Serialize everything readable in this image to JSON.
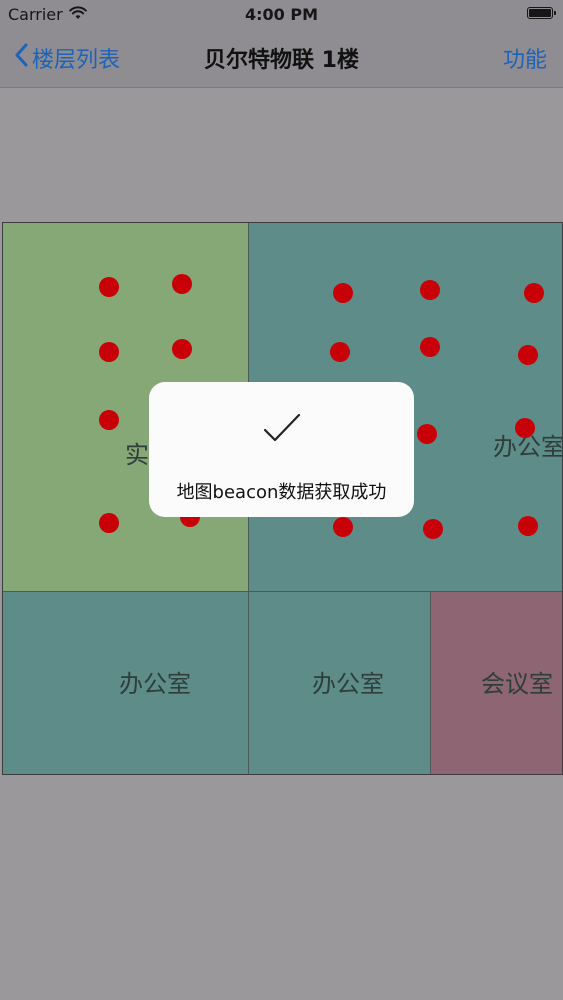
{
  "status_bar": {
    "carrier": "Carrier",
    "time": "4:00 PM",
    "battery_level": 1.0
  },
  "nav": {
    "back_label": "楼层列表",
    "title": "贝尔特物联 1楼",
    "right_label": "功能"
  },
  "map": {
    "rooms": [
      {
        "id": "lab",
        "label": "实",
        "color": "#86a776"
      },
      {
        "id": "office-top-right",
        "label": "办公室",
        "color": "#5e8d89"
      },
      {
        "id": "office-bottom-left",
        "label": "办公室",
        "color": "#5e8d89"
      },
      {
        "id": "office-bottom-middle",
        "label": "办公室",
        "color": "#5e8d89"
      },
      {
        "id": "meeting-room",
        "label": "会议室",
        "color": "#8e6572"
      }
    ],
    "beacon_color": "#c80008"
  },
  "toast": {
    "icon": "checkmark-icon",
    "message": "地图beacon数据获取成功"
  }
}
